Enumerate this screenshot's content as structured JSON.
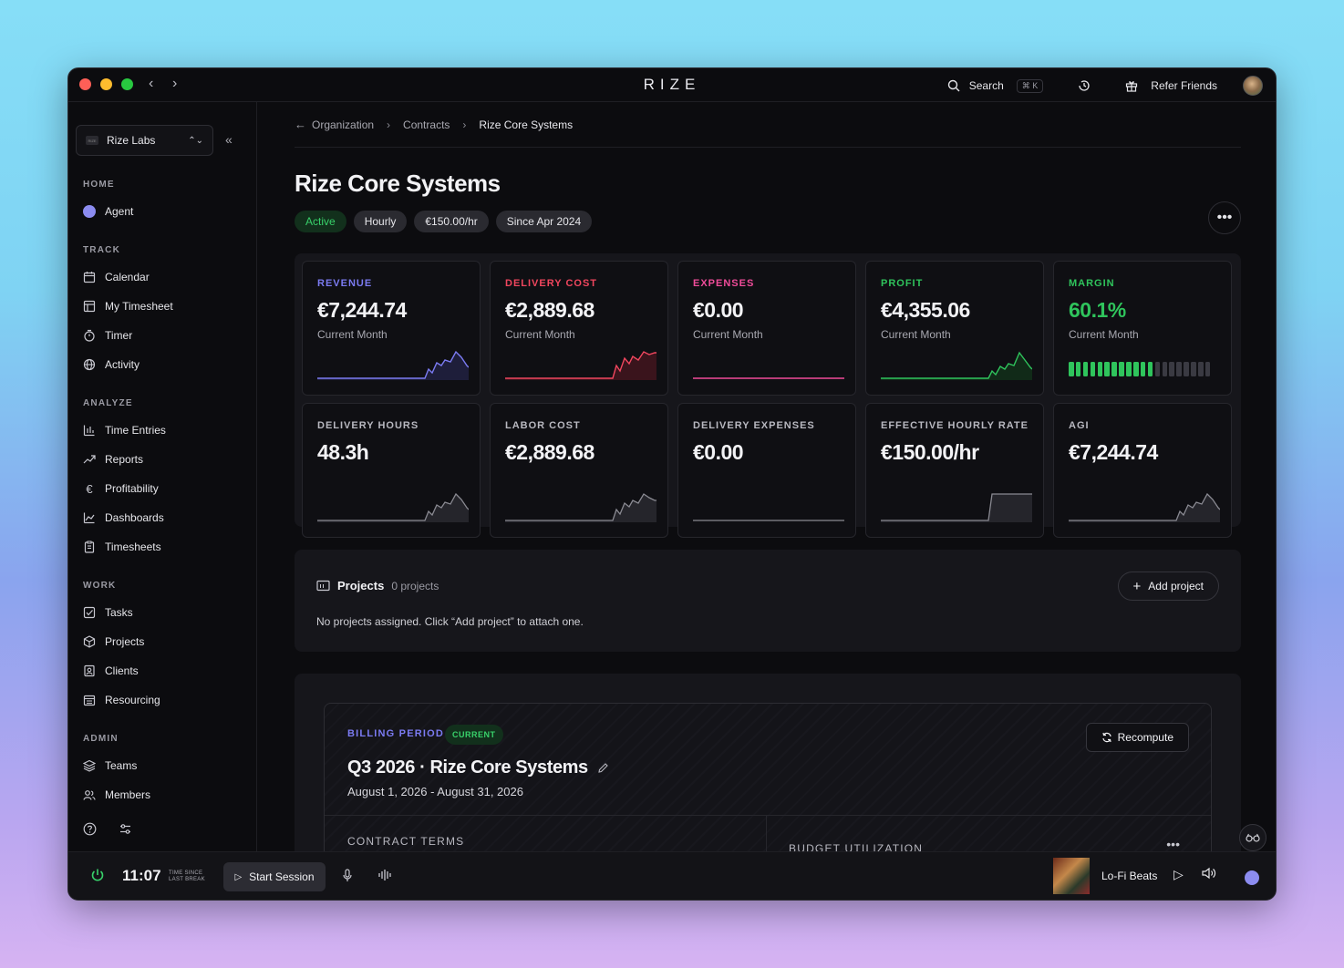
{
  "app": {
    "title": "RIZE",
    "search_label": "Search",
    "search_shortcut": "⌘ K",
    "refer_label": "Refer Friends"
  },
  "sidebar": {
    "org_name": "Rize Labs",
    "org_logo_text": "RIZE",
    "sections": {
      "home": "HOME",
      "track": "TRACK",
      "analyze": "ANALYZE",
      "work": "WORK",
      "admin": "ADMIN"
    },
    "items": {
      "agent": "Agent",
      "calendar": "Calendar",
      "timesheet": "My Timesheet",
      "timer": "Timer",
      "activity": "Activity",
      "time_entries": "Time Entries",
      "reports": "Reports",
      "profitability": "Profitability",
      "dashboards": "Dashboards",
      "timesheets": "Timesheets",
      "tasks": "Tasks",
      "projects": "Projects",
      "clients": "Clients",
      "resourcing": "Resourcing",
      "teams": "Teams",
      "members": "Members"
    }
  },
  "breadcrumb": {
    "org": "Organization",
    "contracts": "Contracts",
    "current": "Rize Core Systems"
  },
  "page": {
    "title": "Rize Core Systems",
    "badges": {
      "status": "Active",
      "type": "Hourly",
      "rate": "€150.00/hr",
      "since": "Since Apr 2024"
    }
  },
  "metrics": {
    "revenue": {
      "label": "REVENUE",
      "value": "€7,244.74",
      "sub": "Current Month",
      "color": "#7b7bf2"
    },
    "delivery_cost": {
      "label": "DELIVERY COST",
      "value": "€2,889.68",
      "sub": "Current Month",
      "color": "#f0465e"
    },
    "expenses": {
      "label": "EXPENSES",
      "value": "€0.00",
      "sub": "Current Month",
      "color": "#f04c9a"
    },
    "profit": {
      "label": "PROFIT",
      "value": "€4,355.06",
      "sub": "Current Month",
      "color": "#2fc45c"
    },
    "margin": {
      "label": "MARGIN",
      "value": "60.1%",
      "sub": "Current Month",
      "color": "#2fc45c",
      "filled_segments": 12,
      "total_segments": 20
    },
    "delivery_hours": {
      "label": "DELIVERY HOURS",
      "value": "48.3h"
    },
    "labor_cost": {
      "label": "LABOR COST",
      "value": "€2,889.68"
    },
    "delivery_expenses": {
      "label": "DELIVERY EXPENSES",
      "value": "€0.00"
    },
    "effective_rate": {
      "label": "EFFECTIVE HOURLY RATE",
      "value": "€150.00/hr"
    },
    "agi": {
      "label": "AGI",
      "value": "€7,244.74"
    }
  },
  "projects": {
    "title": "Projects",
    "count": "0 projects",
    "add_label": "Add project",
    "empty_text": "No projects assigned. Click “Add project” to attach one."
  },
  "billing": {
    "label": "BILLING PERIOD",
    "status": "CURRENT",
    "title": "Q3 2026 · Rize Core Systems",
    "dates": "August 1, 2026 - August 31, 2026",
    "recompute_label": "Recompute",
    "contract_terms": "CONTRACT TERMS",
    "budget_utilization": "BUDGET UTILIZATION"
  },
  "bottombar": {
    "clock": "11:07",
    "since_line1": "TIME SINCE",
    "since_line2": "LAST BREAK",
    "start_label": "Start Session",
    "track_name": "Lo-Fi Beats"
  }
}
